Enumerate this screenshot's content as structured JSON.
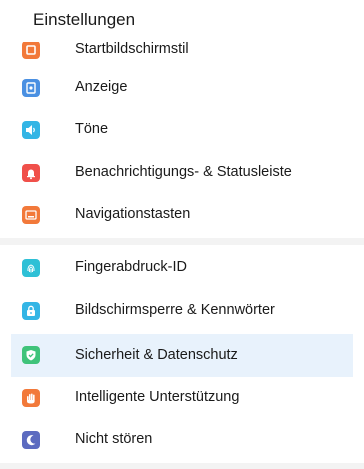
{
  "header": {
    "title": "Einstellungen"
  },
  "colors": {
    "orange": "#f2793a",
    "blue": "#4a90e2",
    "cyan": "#33b5e5",
    "red": "#f0504a",
    "teal": "#2ec0d6",
    "green": "#3fc37a",
    "purple": "#5c6bc0",
    "selected_bg": "#e8f2fc"
  },
  "settings": {
    "items": [
      {
        "label": "Startbildschirmstil",
        "icon": "home-style-icon"
      },
      {
        "label": "Anzeige",
        "icon": "display-icon"
      },
      {
        "label": "Töne",
        "icon": "sound-icon"
      },
      {
        "label": "Benachrichtigungs- & Statusleiste",
        "icon": "bell-icon"
      },
      {
        "label": "Navigationstasten",
        "icon": "navigation-keys-icon"
      },
      {
        "label": "Fingerabdruck-ID",
        "icon": "fingerprint-icon"
      },
      {
        "label": "Bildschirmsperre & Kennwörter",
        "icon": "lock-icon"
      },
      {
        "label": "Sicherheit & Datenschutz",
        "icon": "shield-icon",
        "selected": true
      },
      {
        "label": "Intelligente Unterstützung",
        "icon": "hand-icon"
      },
      {
        "label": "Nicht stören",
        "icon": "moon-icon"
      }
    ]
  }
}
